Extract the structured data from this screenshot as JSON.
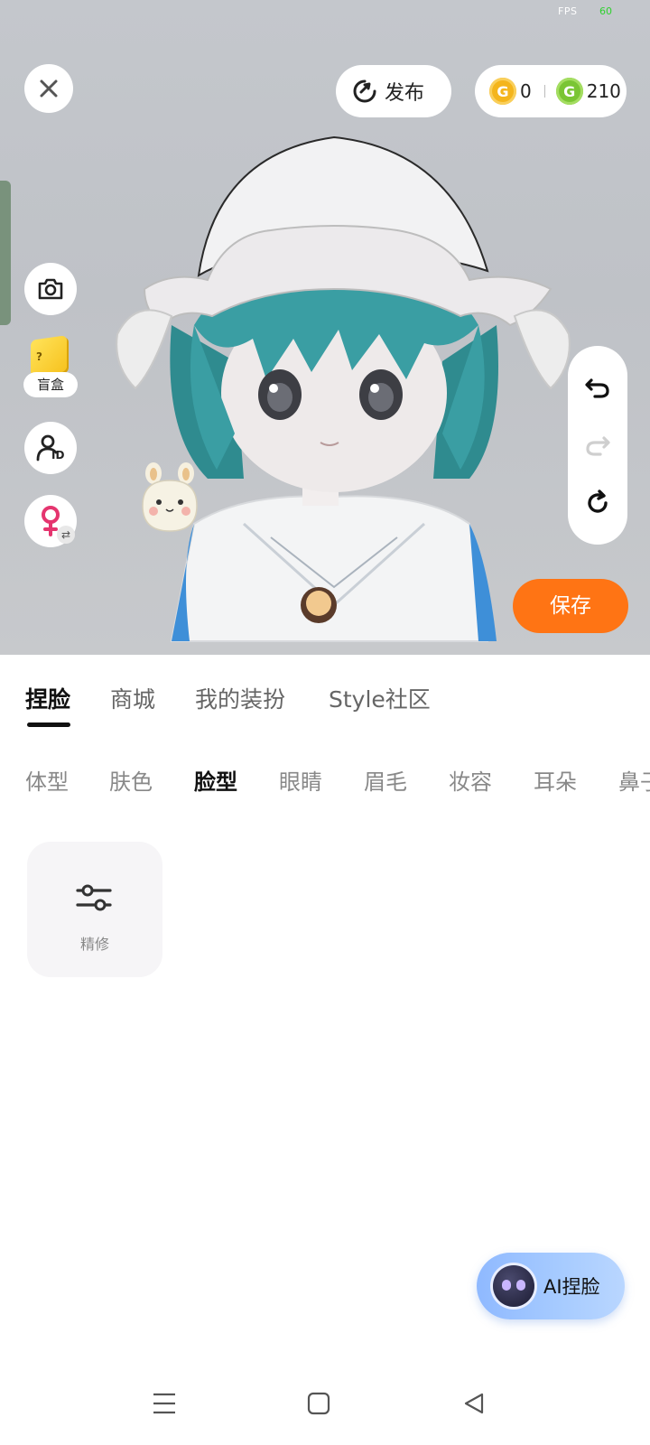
{
  "status": {
    "fps_label": "FPS",
    "fps_value": "60"
  },
  "toolbar": {
    "publish_label": "发布",
    "coins": [
      {
        "icon": "gold-coin-icon",
        "value": "0"
      },
      {
        "icon": "green-coin-icon",
        "value": "210"
      }
    ]
  },
  "side_tools": {
    "camera": "camera-icon",
    "blindbox_label": "盲盒",
    "blindbox_mark": "?",
    "id_badge": "ID",
    "gender_swap": "⇄"
  },
  "history": {
    "undo": "undo-icon",
    "redo": "redo-icon",
    "reset": "reset-icon"
  },
  "save_label": "保存",
  "tabs": [
    {
      "label": "捏脸",
      "active": true
    },
    {
      "label": "商城",
      "active": false
    },
    {
      "label": "我的装扮",
      "active": false
    },
    {
      "label": "Style社区",
      "active": false
    }
  ],
  "subtabs": [
    {
      "label": "体型",
      "active": false
    },
    {
      "label": "肤色",
      "active": false
    },
    {
      "label": "脸型",
      "active": true
    },
    {
      "label": "眼睛",
      "active": false
    },
    {
      "label": "眉毛",
      "active": false
    },
    {
      "label": "妆容",
      "active": false
    },
    {
      "label": "耳朵",
      "active": false
    },
    {
      "label": "鼻子",
      "active": false
    }
  ],
  "tiles": [
    {
      "label": "精修",
      "icon": "sliders-icon"
    }
  ],
  "ai_button_label": "AI捏脸",
  "colors": {
    "accent_orange": "#ff7414",
    "ai_blue": "#9fc4ff",
    "gold_coin": "#f4b51c",
    "green_coin": "#7ac534"
  }
}
